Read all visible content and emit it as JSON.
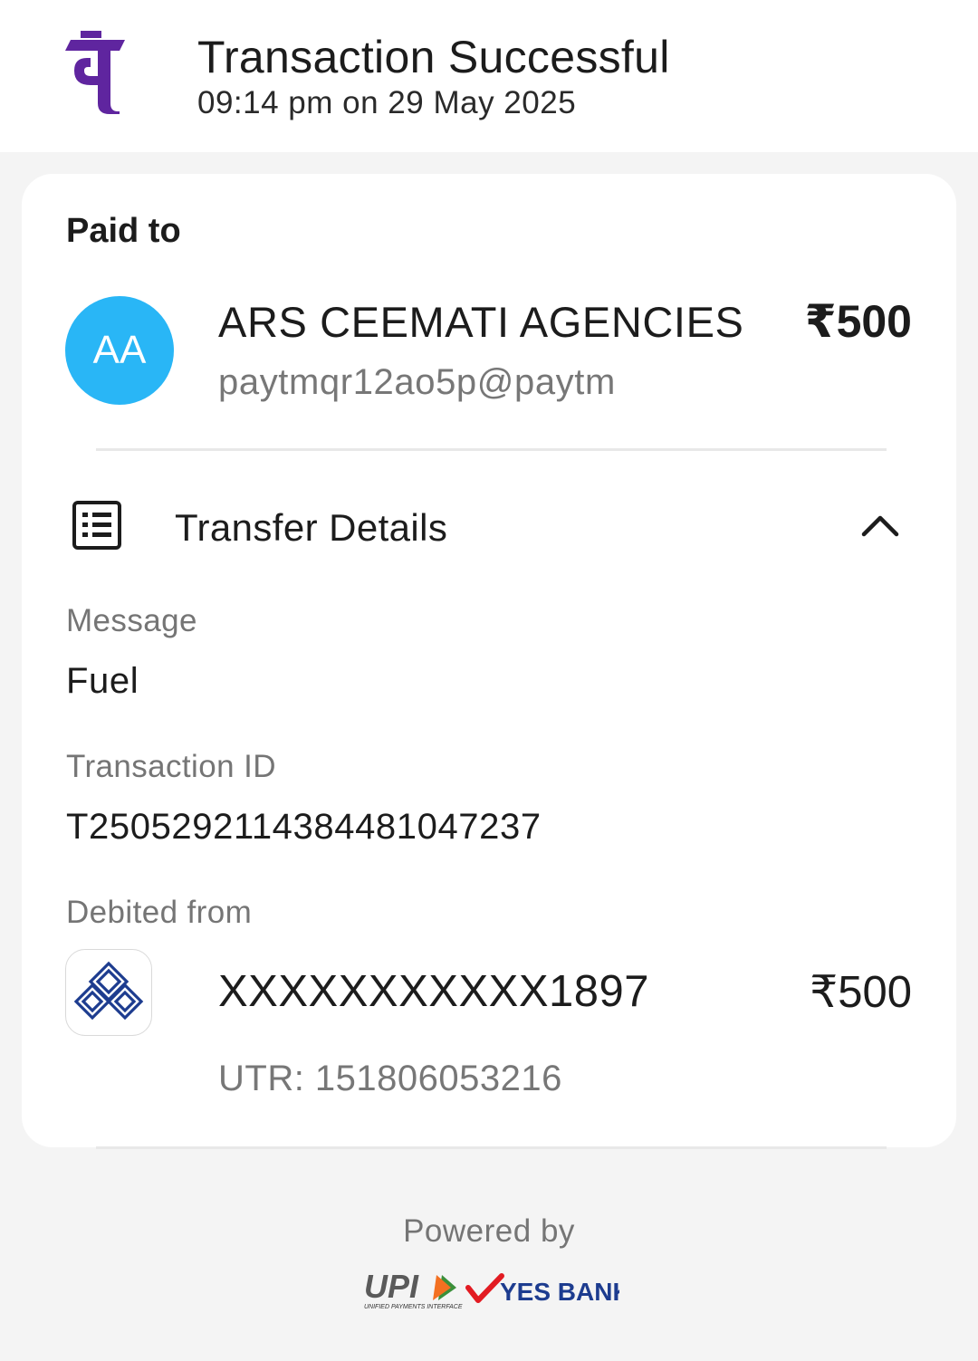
{
  "header": {
    "logo_icon": "phonepe-logo-icon",
    "title": "Transaction Successful",
    "timestamp": "09:14 pm on 29 May 2025"
  },
  "paid_to": {
    "label": "Paid to",
    "avatar_initials": "AA",
    "avatar_color": "#29b6f6",
    "name": "ARS CEEMATI AGENCIES",
    "upi_id": "paytmqr12ao5p@paytm",
    "amount": "₹500"
  },
  "transfer_details": {
    "icon": "receipt-list-icon",
    "title": "Transfer Details",
    "toggle_icon": "chevron-up-icon",
    "expanded": true,
    "message_label": "Message",
    "message_value": "Fuel",
    "transaction_id_label": "Transaction ID",
    "transaction_id_value": "T2505292114384481047237",
    "debited_from_label": "Debited from",
    "bank_icon": "bank-logo-icon",
    "account_number": "XXXXXXXXXXX1897",
    "account_amount": "₹500",
    "utr": "UTR: 151806053216"
  },
  "footer": {
    "powered_by": "Powered by",
    "upi_logo_text": "UPI",
    "upi_subtext": "UNIFIED PAYMENTS INTERFACE",
    "partner_bank": "YES BANK"
  },
  "colors": {
    "brand_purple": "#5f259f",
    "yes_bank_blue": "#1d3c8f",
    "yes_bank_red": "#e21b22",
    "background": "#f4f4f4"
  }
}
